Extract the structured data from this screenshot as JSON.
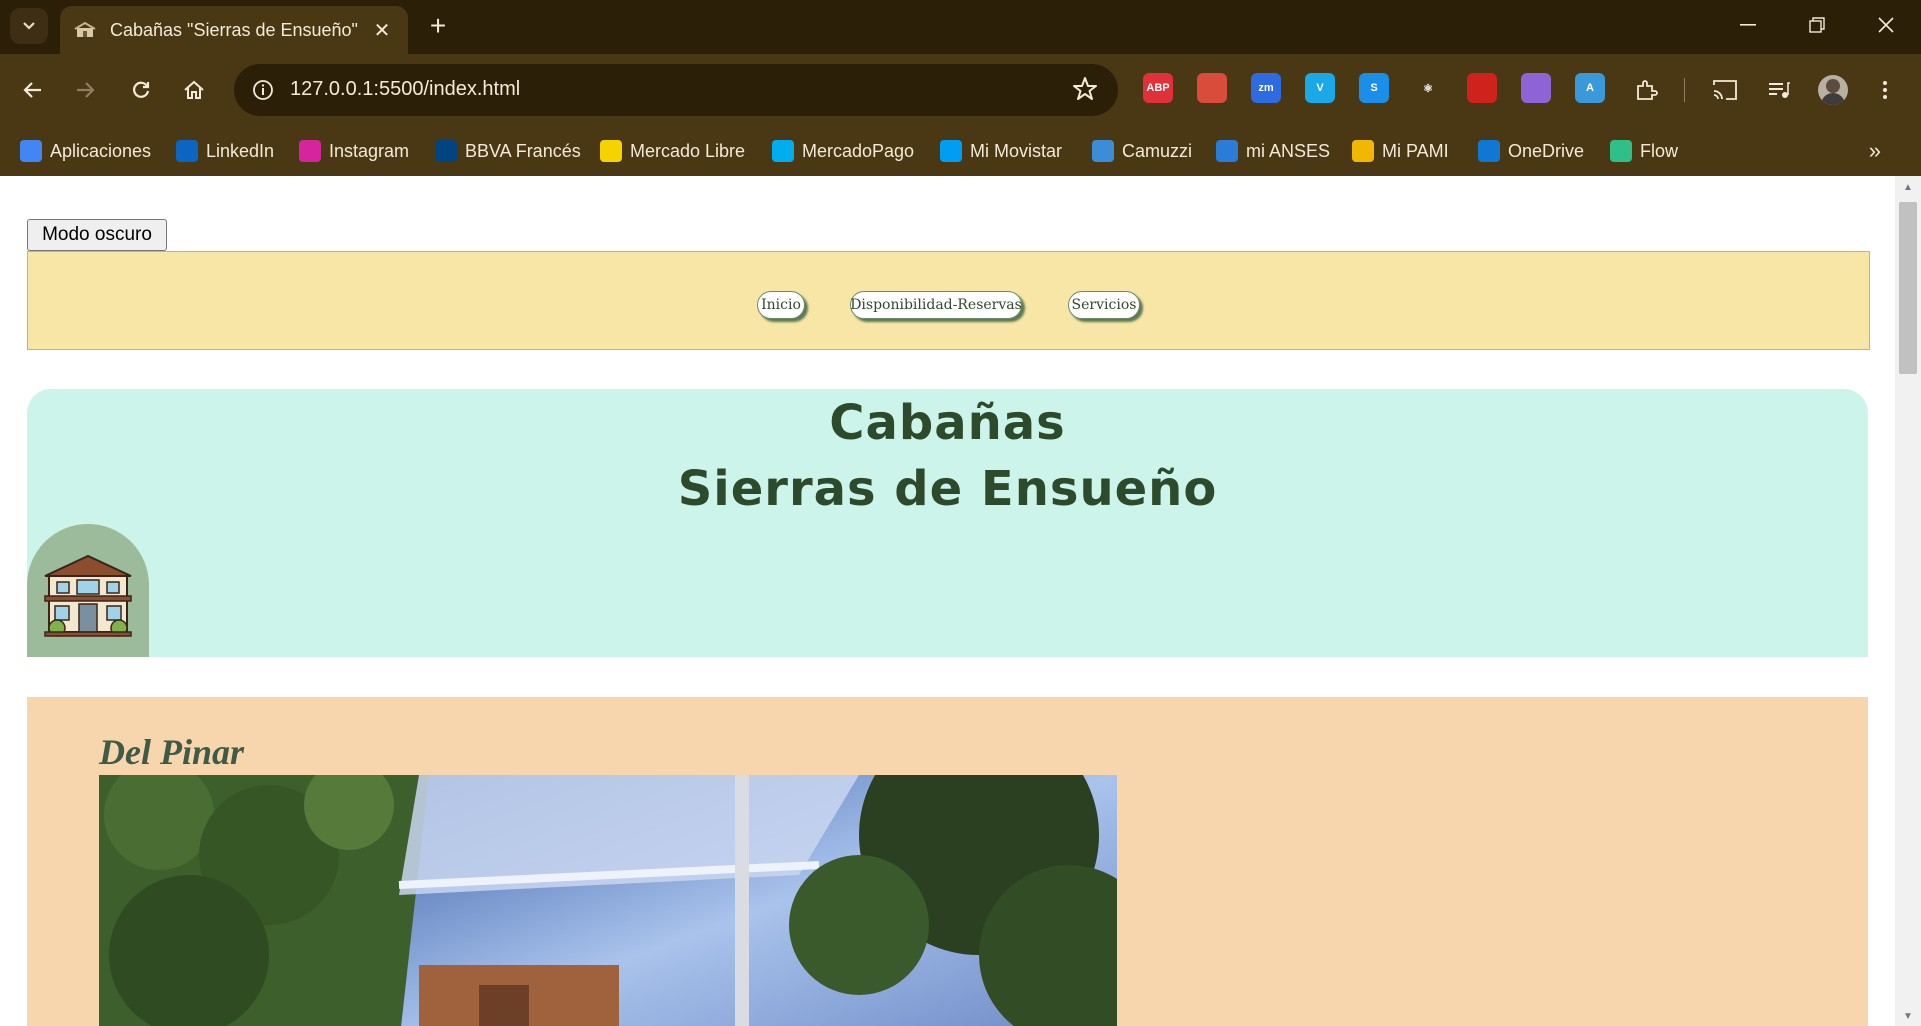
{
  "browser": {
    "tab": {
      "title": "Cabañas \"Sierras de Ensueño\""
    },
    "url": "127.0.0.1:5500/index.html",
    "extensions": [
      {
        "name": "abp-icon",
        "label": "ABP",
        "color": "#e0303a"
      },
      {
        "name": "gallery-icon",
        "label": "",
        "color": "#d94b3b"
      },
      {
        "name": "zoom-icon",
        "label": "zm",
        "color": "#2d6be3"
      },
      {
        "name": "vimeo-icon",
        "label": "V",
        "color": "#1aa8e8"
      },
      {
        "name": "shazam-icon",
        "label": "S",
        "color": "#1a8fe8"
      },
      {
        "name": "react-icon",
        "label": "⚛",
        "color": "#4a3713"
      },
      {
        "name": "pdf-icon",
        "label": "",
        "color": "#d0221c"
      },
      {
        "name": "drop-icon",
        "label": "",
        "color": "#8e63d6"
      },
      {
        "name": "translate-icon",
        "label": "A",
        "color": "#3a9ad9"
      }
    ],
    "bookmarks": [
      {
        "label": "Aplicaciones",
        "icon": "apps-grid-icon",
        "color": "#4285f4"
      },
      {
        "label": "LinkedIn",
        "icon": "linkedin-icon",
        "color": "#0a66c2"
      },
      {
        "label": "Instagram",
        "icon": "instagram-icon",
        "color": "#d6249f"
      },
      {
        "label": "BBVA Francés",
        "icon": "bbva-icon",
        "color": "#004481"
      },
      {
        "label": "Mercado Libre",
        "icon": "mercadolibre-icon",
        "color": "#f5d300"
      },
      {
        "label": "MercadoPago",
        "icon": "mercadopago-icon",
        "color": "#00aeef"
      },
      {
        "label": "Mi Movistar",
        "icon": "movistar-icon",
        "color": "#019df4"
      },
      {
        "label": "Camuzzi",
        "icon": "camuzzi-icon",
        "color": "#3a8dd6"
      },
      {
        "label": "mi ANSES",
        "icon": "anses-icon",
        "color": "#2b7bd8"
      },
      {
        "label": "Mi PAMI",
        "icon": "pami-icon",
        "color": "#f2b705"
      },
      {
        "label": "OneDrive",
        "icon": "onedrive-icon",
        "color": "#0f78d4"
      },
      {
        "label": "Flow",
        "icon": "flow-icon",
        "color": "#2fc08a"
      }
    ]
  },
  "page": {
    "dark_mode_button": "Modo oscuro",
    "nav": [
      {
        "label": "Inicio"
      },
      {
        "label": "Disponibilidad-Reservas"
      },
      {
        "label": "Servicios"
      }
    ],
    "hero": {
      "title_line1": "Cabañas",
      "title_line2": "Sierras de Ensueño"
    },
    "card": {
      "title": "Del Pinar"
    }
  },
  "colors": {
    "chrome_dark": "#2c1f08",
    "chrome": "#4a3713",
    "nav_band": "#f7e6a6",
    "hero_bg": "#cdf4ea",
    "card_bg": "#f7d5ad",
    "title_green": "#2e4a2d"
  }
}
